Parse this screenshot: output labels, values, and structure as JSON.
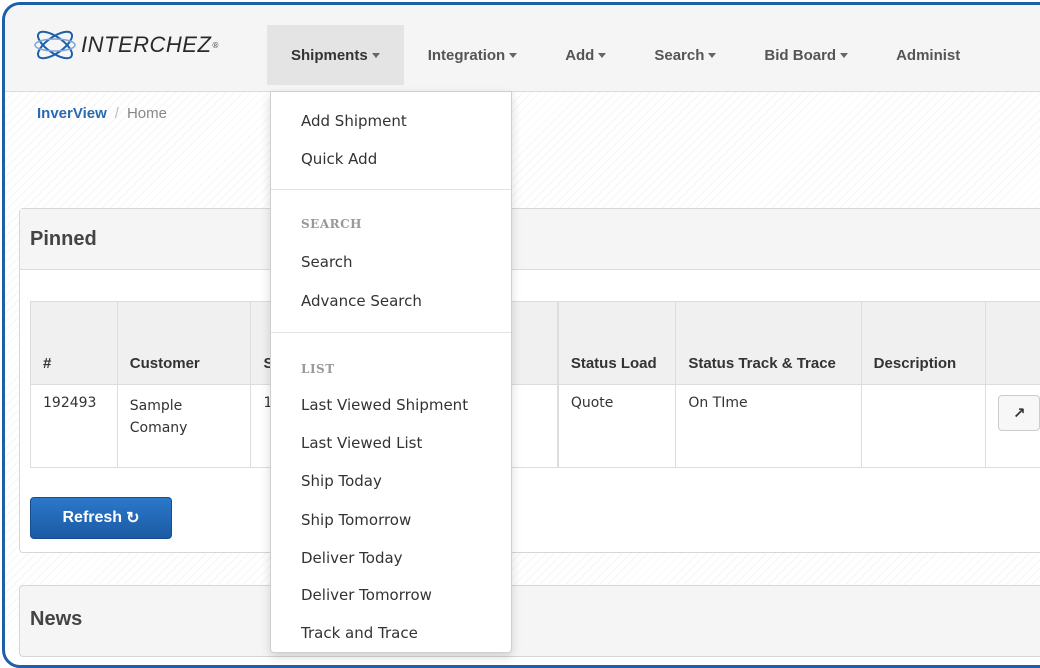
{
  "brand": {
    "name": "INTERCHEZ",
    "trademark": "®"
  },
  "nav": {
    "items": [
      {
        "label": "Shipments",
        "active": true
      },
      {
        "label": "Integration",
        "active": false
      },
      {
        "label": "Add",
        "active": false
      },
      {
        "label": "Search",
        "active": false
      },
      {
        "label": "Bid Board",
        "active": false
      },
      {
        "label": "Administ",
        "active": false
      }
    ]
  },
  "breadcrumb": {
    "link": "InverView",
    "separator": "/",
    "current": "Home"
  },
  "pinned": {
    "title": "Pinned",
    "columns": [
      "#",
      "Customer",
      "S",
      "",
      "Status Load",
      "Status Track & Trace",
      "Description",
      ""
    ],
    "rows": [
      {
        "id": "192493",
        "customer": "Sample Comany",
        "s": "1 1",
        "col4": "",
        "status_load": "Quote",
        "status_track": "On TIme",
        "description": ""
      }
    ],
    "refresh_label": "Refresh"
  },
  "news": {
    "title": "News"
  },
  "dropdown": {
    "items_top": [
      "Add Shipment",
      "Quick Add"
    ],
    "header_search": "SEARCH",
    "items_search": [
      "Search",
      "Advance Search"
    ],
    "header_list": "LIST",
    "items_list": [
      "Last Viewed Shipment",
      "Last Viewed List",
      "Ship Today",
      "Ship Tomorrow",
      "Deliver Today",
      "Deliver Tomorrow",
      "Track and Trace"
    ]
  },
  "colors": {
    "accent": "#1f5ea8",
    "link": "#2a6bb0",
    "button": "#1c5aa4"
  },
  "icons": {
    "refresh": "refresh-icon",
    "external": "external-link-icon",
    "logo": "orbit-logo-icon"
  }
}
